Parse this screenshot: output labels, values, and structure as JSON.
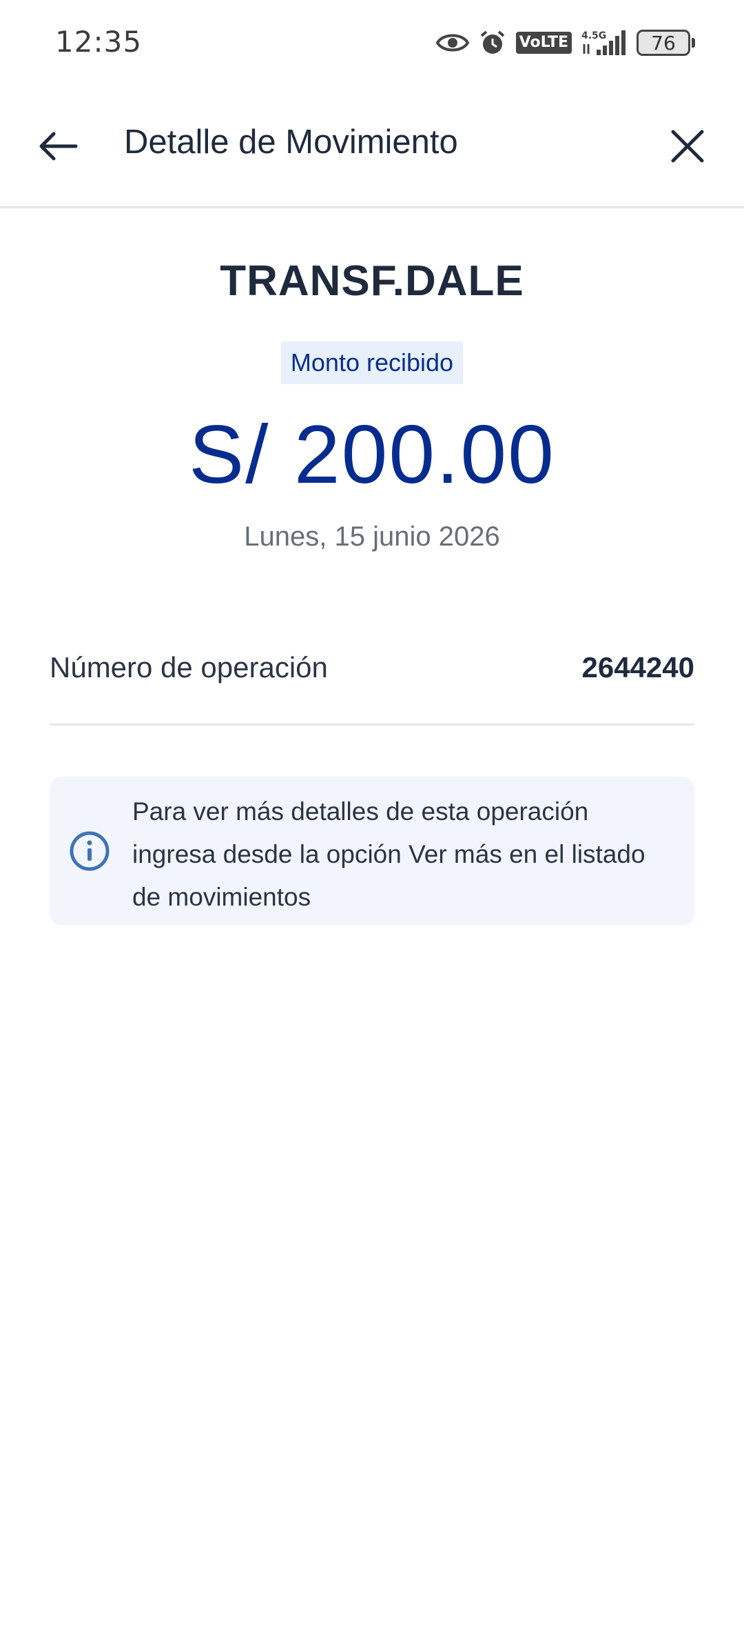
{
  "status_bar": {
    "time": "12:35",
    "network": "4.5G",
    "volte": "VoLTE",
    "battery": "76"
  },
  "app_bar": {
    "title": "Detalle de Movimiento"
  },
  "movement": {
    "merchant": "TRANSF.DALE",
    "badge": "Monto recibido",
    "amount": "S/ 200.00",
    "date": "Lunes, 15 junio 2026"
  },
  "operation": {
    "label": "Número de operación",
    "value": "2644240"
  },
  "info": {
    "text": "Para ver más detalles de esta operación ingresa desde la opción Ver más en el listado de movimientos"
  },
  "colors": {
    "amount": "#062c8f",
    "badge_bg": "#e8f0fb",
    "info_bg": "#f2f6fc",
    "info_icon": "#3f72b8"
  }
}
